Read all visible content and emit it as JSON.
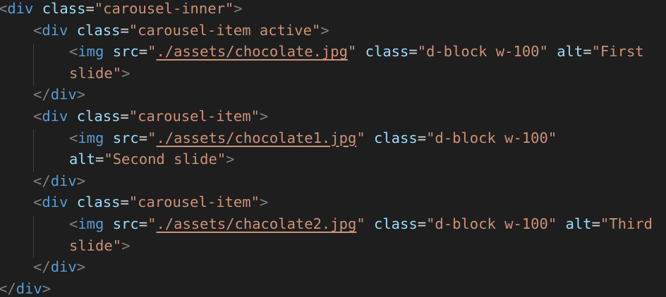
{
  "lines": [
    [
      {
        "t": "<",
        "c": "punc"
      },
      {
        "t": "div",
        "c": "tag"
      },
      {
        "t": " "
      },
      {
        "t": "class",
        "c": "attr"
      },
      {
        "t": "=",
        "c": "eq"
      },
      {
        "t": "\"carousel-inner\"",
        "c": "str"
      },
      {
        "t": ">",
        "c": "punc"
      }
    ],
    [
      {
        "t": "<",
        "c": "punc"
      },
      {
        "t": "div",
        "c": "tag"
      },
      {
        "t": " "
      },
      {
        "t": "class",
        "c": "attr"
      },
      {
        "t": "=",
        "c": "eq"
      },
      {
        "t": "\"carousel-item active\"",
        "c": "str"
      },
      {
        "t": ">",
        "c": "punc"
      }
    ],
    [
      {
        "t": "<",
        "c": "punc"
      },
      {
        "t": "img",
        "c": "tag"
      },
      {
        "t": " "
      },
      {
        "t": "src",
        "c": "attr"
      },
      {
        "t": "=",
        "c": "eq"
      },
      {
        "t": "\"",
        "c": "str"
      },
      {
        "t": "./assets/chocolate.jpg",
        "c": "link"
      },
      {
        "t": "\"",
        "c": "str"
      },
      {
        "t": " "
      },
      {
        "t": "class",
        "c": "attr"
      },
      {
        "t": "=",
        "c": "eq"
      },
      {
        "t": "\"d-block w-100\"",
        "c": "str"
      },
      {
        "t": " "
      },
      {
        "t": "alt",
        "c": "attr"
      },
      {
        "t": "=",
        "c": "eq"
      },
      {
        "t": "\"First",
        "c": "str"
      }
    ],
    [
      {
        "t": "slide\"",
        "c": "str"
      },
      {
        "t": ">",
        "c": "punc"
      }
    ],
    [
      {
        "t": "</",
        "c": "punc"
      },
      {
        "t": "div",
        "c": "tag"
      },
      {
        "t": ">",
        "c": "punc"
      }
    ],
    [
      {
        "t": "<",
        "c": "punc"
      },
      {
        "t": "div",
        "c": "tag"
      },
      {
        "t": " "
      },
      {
        "t": "class",
        "c": "attr"
      },
      {
        "t": "=",
        "c": "eq"
      },
      {
        "t": "\"carousel-item\"",
        "c": "str"
      },
      {
        "t": ">",
        "c": "punc"
      }
    ],
    [
      {
        "t": "<",
        "c": "punc"
      },
      {
        "t": "img",
        "c": "tag"
      },
      {
        "t": " "
      },
      {
        "t": "src",
        "c": "attr"
      },
      {
        "t": "=",
        "c": "eq"
      },
      {
        "t": "\"",
        "c": "str"
      },
      {
        "t": "./assets/chocolate1.jpg",
        "c": "link"
      },
      {
        "t": "\"",
        "c": "str"
      },
      {
        "t": " "
      },
      {
        "t": "class",
        "c": "attr"
      },
      {
        "t": "=",
        "c": "eq"
      },
      {
        "t": "\"d-block w-100\"",
        "c": "str"
      }
    ],
    [
      {
        "t": "alt",
        "c": "attr"
      },
      {
        "t": "=",
        "c": "eq"
      },
      {
        "t": "\"Second slide\"",
        "c": "str"
      },
      {
        "t": ">",
        "c": "punc"
      }
    ],
    [
      {
        "t": "</",
        "c": "punc"
      },
      {
        "t": "div",
        "c": "tag"
      },
      {
        "t": ">",
        "c": "punc"
      }
    ],
    [
      {
        "t": "<",
        "c": "punc"
      },
      {
        "t": "div",
        "c": "tag"
      },
      {
        "t": " "
      },
      {
        "t": "class",
        "c": "attr"
      },
      {
        "t": "=",
        "c": "eq"
      },
      {
        "t": "\"carousel-item\"",
        "c": "str"
      },
      {
        "t": ">",
        "c": "punc"
      }
    ],
    [
      {
        "t": "<",
        "c": "punc"
      },
      {
        "t": "img",
        "c": "tag"
      },
      {
        "t": " "
      },
      {
        "t": "src",
        "c": "attr"
      },
      {
        "t": "=",
        "c": "eq"
      },
      {
        "t": "\"",
        "c": "str"
      },
      {
        "t": "./assets/chacolate2.jpg",
        "c": "link"
      },
      {
        "t": "\"",
        "c": "str"
      },
      {
        "t": " "
      },
      {
        "t": "class",
        "c": "attr"
      },
      {
        "t": "=",
        "c": "eq"
      },
      {
        "t": "\"d-block w-100\"",
        "c": "str"
      },
      {
        "t": " "
      },
      {
        "t": "alt",
        "c": "attr"
      },
      {
        "t": "=",
        "c": "eq"
      },
      {
        "t": "\"Third",
        "c": "str"
      }
    ],
    [
      {
        "t": "slide\"",
        "c": "str"
      },
      {
        "t": ">",
        "c": "punc"
      }
    ],
    [
      {
        "t": "</",
        "c": "punc"
      },
      {
        "t": "div",
        "c": "tag"
      },
      {
        "t": ">",
        "c": "punc"
      }
    ],
    [
      {
        "t": "</",
        "c": "punc"
      },
      {
        "t": "div",
        "c": "tag"
      },
      {
        "t": ">",
        "c": "punc"
      }
    ]
  ]
}
